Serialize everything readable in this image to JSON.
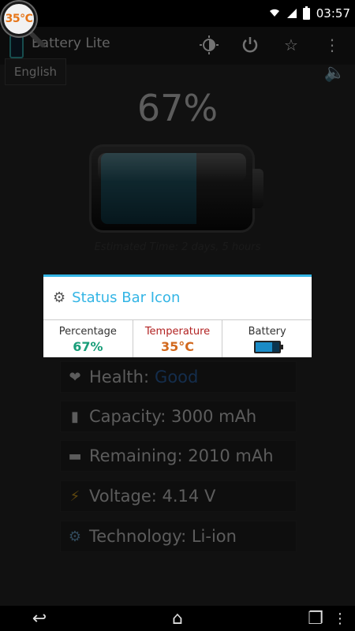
{
  "status_bar": {
    "temperature_badge": "35°C",
    "time": "03:57"
  },
  "action_bar": {
    "title": "Battery Lite",
    "icons": [
      "brightness-icon",
      "power-icon",
      "star-icon",
      "overflow-menu-icon"
    ]
  },
  "main": {
    "language_button": "English",
    "battery_percent": "67%",
    "battery_level": 0.67,
    "estimated_time": "Estimated Time: 2 days, 5 hours",
    "info_rows": [
      {
        "icon": "heart-icon",
        "label": "Health:",
        "value": "Good"
      },
      {
        "icon": "battery-capacity-icon",
        "text": "Capacity: 3000 mAh"
      },
      {
        "icon": "battery-remaining-icon",
        "text": "Remaining: 2010 mAh"
      },
      {
        "icon": "voltage-icon",
        "text": "Voltage: 4.14 V"
      },
      {
        "icon": "gear-icon",
        "text": "Technology: Li-ion"
      }
    ]
  },
  "dialog": {
    "title": "Status Bar Icon",
    "options": [
      {
        "label": "Percentage",
        "value": "67%",
        "label_color": "#333333",
        "value_color": "#1a9e7a"
      },
      {
        "label": "Temperature",
        "value": "35°C",
        "label_color": "#b22222",
        "value_color": "#d2691e"
      },
      {
        "label": "Battery",
        "value": ""
      }
    ]
  },
  "colors": {
    "accent": "#33b5e5",
    "good": "#2d65a8"
  }
}
